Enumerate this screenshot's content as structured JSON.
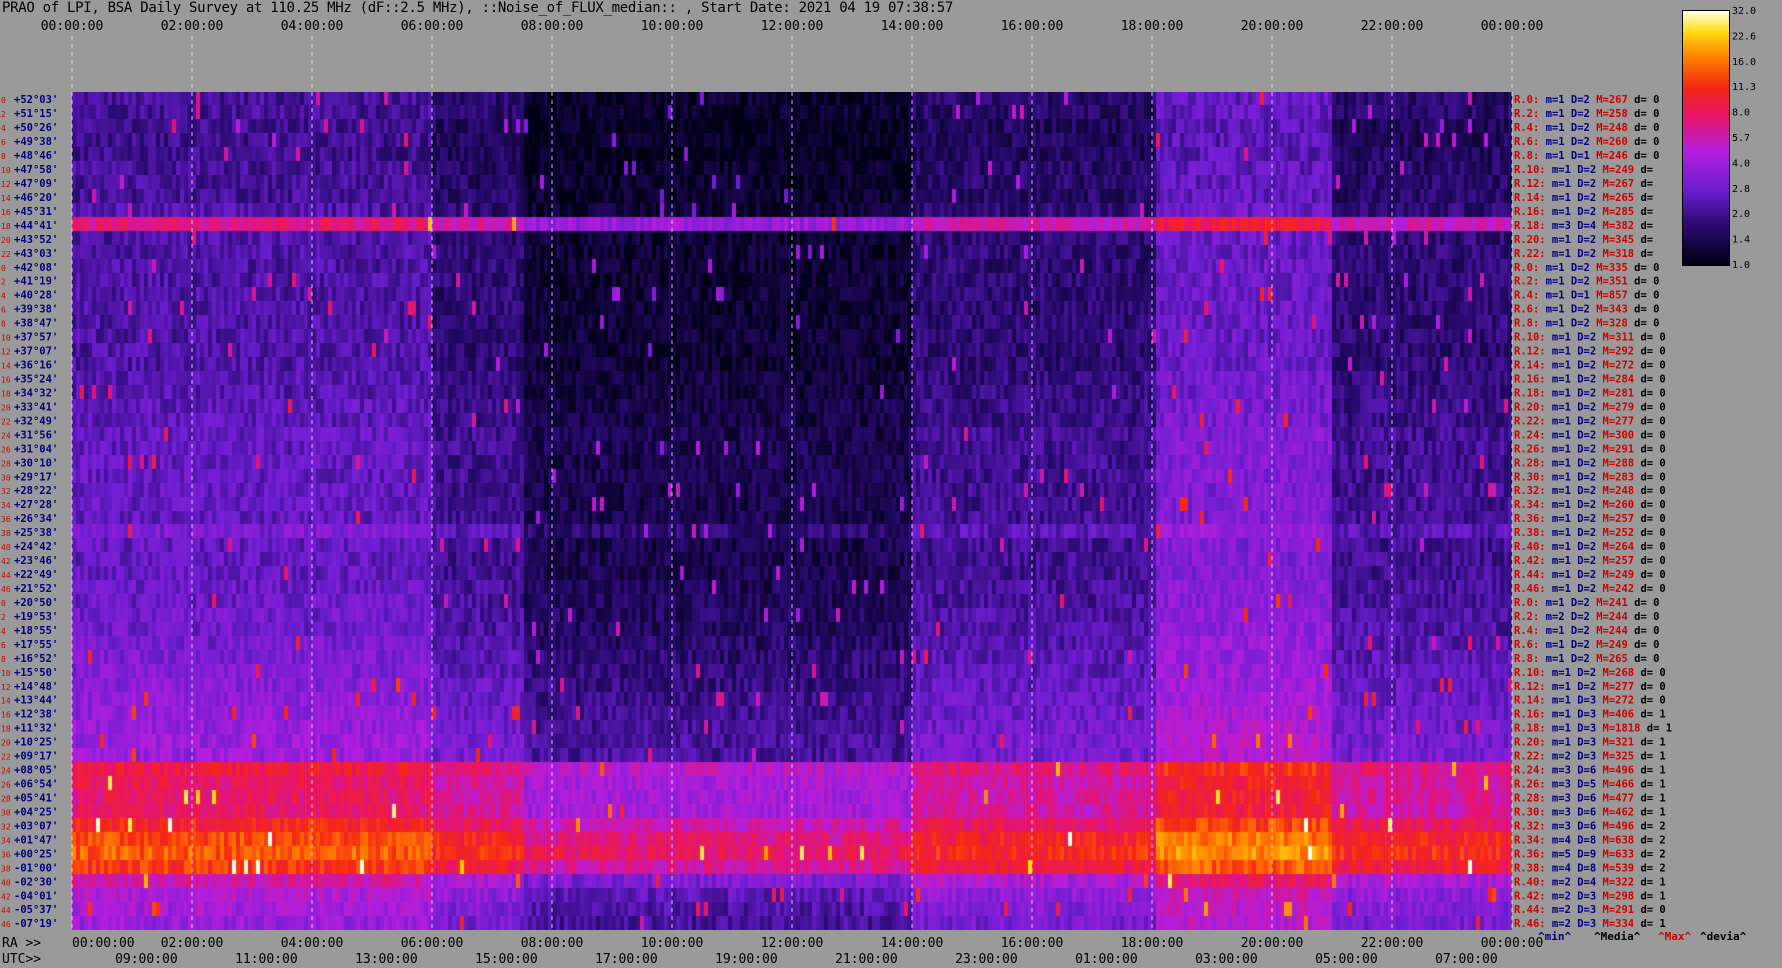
{
  "title": "PRAO of LPI, BSA Daily Survey at 110.25 MHz (dF::2.5 MHz), ::Noise_of_FLUX_median:: , Start Date: 2021 04 19 07:38:57",
  "top_axis": [
    "00:00:00",
    "02:00:00",
    "04:00:00",
    "06:00:00",
    "08:00:00",
    "10:00:00",
    "12:00:00",
    "14:00:00",
    "16:00:00",
    "18:00:00",
    "20:00:00",
    "22:00:00",
    "00:00:00"
  ],
  "bottom_ra_prefix": "RA >>",
  "bottom_ra": [
    "00:00:00",
    "02:00:00",
    "04:00:00",
    "06:00:00",
    "08:00:00",
    "10:00:00",
    "12:00:00",
    "14:00:00",
    "16:00:00",
    "18:00:00",
    "20:00:00",
    "22:00:00",
    "00:00:00"
  ],
  "bottom_utc_prefix": "UTC>>",
  "bottom_utc": [
    "09:00:00",
    "11:00:00",
    "13:00:00",
    "15:00:00",
    "17:00:00",
    "19:00:00",
    "21:00:00",
    "23:00:00",
    "01:00:00",
    "03:00:00",
    "05:00:00",
    "07:00:00"
  ],
  "colorbar": {
    "ticks": [
      "32.0",
      "22.6",
      "16.0",
      "11.3",
      "8.0",
      "5.7",
      "4.0",
      "2.8",
      "2.0",
      "1.4",
      "1.0"
    ]
  },
  "legend": {
    "min": "^min^",
    "median": "^Media^",
    "max": "^Max^",
    "devia": "^devia^"
  },
  "colors": {
    "bg": "#9a9a9a",
    "label_red": "#d00000",
    "label_navy": "#000080"
  },
  "chart_data": {
    "type": "heatmap",
    "title": "PRAO of LPI, BSA Daily Survey at 110.25 MHz (dF::2.5 MHz), ::Noise_of_FLUX_median:: , Start Date: 2021 04 19 07:38:57",
    "x_axis": "RA 00:00:00 to 00:00:00 (24 h)",
    "colorscale": {
      "min": 1.0,
      "max": 32.0,
      "scale": "log2"
    },
    "declinations": [
      "+52°03'",
      "+51°15'",
      "+50°26'",
      "+49°38'",
      "+48°46'",
      "+47°58'",
      "+47°09'",
      "+46°20'",
      "+45°31'",
      "+44°41'",
      "+43°52'",
      "+43°03'",
      "+42°08'",
      "+41°19'",
      "+40°28'",
      "+39°38'",
      "+38°47'",
      "+37°57'",
      "+37°07'",
      "+36°16'",
      "+35°24'",
      "+34°32'",
      "+33°41'",
      "+32°49'",
      "+31°56'",
      "+31°04'",
      "+30°10'",
      "+29°17'",
      "+28°22'",
      "+27°28'",
      "+26°34'",
      "+25°38'",
      "+24°42'",
      "+23°46'",
      "+22°49'",
      "+21°52'",
      "+20°50'",
      "+19°53'",
      "+18°55'",
      "+17°55'",
      "+16°52'",
      "+15°50'",
      "+14°48'",
      "+13°44'",
      "+12°38'",
      "+11°32'",
      "+10°25'",
      "+09°17'",
      "+08°05'",
      "+06°54'",
      "+05°41'",
      "+04°25'",
      "+03°07'",
      "+01°47'",
      "+00°25'",
      "-01°00'",
      "-02°30'",
      "-04°01'",
      "-05°37'",
      "-07°19'"
    ],
    "row_index_labels": [
      "0",
      "2",
      "4",
      "6",
      "8",
      "10",
      "12",
      "14",
      "16",
      "18",
      "20",
      "22",
      "0",
      "2",
      "4",
      "6",
      "8",
      "10",
      "12",
      "14",
      "16",
      "18",
      "20",
      "22",
      "24",
      "26",
      "28",
      "30",
      "32",
      "34",
      "36",
      "38",
      "40",
      "42",
      "44",
      "46",
      "0",
      "2",
      "4",
      "6",
      "8",
      "10",
      "12",
      "14",
      "16",
      "18",
      "20",
      "22",
      "24",
      "26",
      "28",
      "30",
      "32",
      "34",
      "36",
      "38",
      "40",
      "42",
      "44",
      "46"
    ],
    "row_stats": [
      {
        "r": "R.0:",
        "m": "1",
        "D": "2",
        "M": "267",
        "d": "0"
      },
      {
        "r": "R.2:",
        "m": "1",
        "D": "2",
        "M": "258",
        "d": "0"
      },
      {
        "r": "R.4:",
        "m": "1",
        "D": "2",
        "M": "248",
        "d": "0"
      },
      {
        "r": "R.6:",
        "m": "1",
        "D": "2",
        "M": "260",
        "d": "0"
      },
      {
        "r": "R.8:",
        "m": "1",
        "D": "1",
        "M": "246",
        "d": "0"
      },
      {
        "r": "R.10:",
        "m": "1",
        "D": "2",
        "M": "249",
        "d": ""
      },
      {
        "r": "R.12:",
        "m": "1",
        "D": "2",
        "M": "267",
        "d": ""
      },
      {
        "r": "R.14:",
        "m": "1",
        "D": "2",
        "M": "265",
        "d": ""
      },
      {
        "r": "R.16:",
        "m": "1",
        "D": "2",
        "M": "285",
        "d": ""
      },
      {
        "r": "R.18:",
        "m": "3",
        "D": "4",
        "M": "382",
        "d": ""
      },
      {
        "r": "R.20:",
        "m": "1",
        "D": "2",
        "M": "345",
        "d": ""
      },
      {
        "r": "R.22:",
        "m": "1",
        "D": "2",
        "M": "318",
        "d": ""
      },
      {
        "r": "R.0:",
        "m": "1",
        "D": "2",
        "M": "335",
        "d": "0"
      },
      {
        "r": "R.2:",
        "m": "1",
        "D": "2",
        "M": "351",
        "d": "0"
      },
      {
        "r": "R.4:",
        "m": "1",
        "D": "1",
        "M": "857",
        "d": "0"
      },
      {
        "r": "R.6:",
        "m": "1",
        "D": "2",
        "M": "343",
        "d": "0"
      },
      {
        "r": "R.8:",
        "m": "1",
        "D": "2",
        "M": "328",
        "d": "0"
      },
      {
        "r": "R.10:",
        "m": "1",
        "D": "2",
        "M": "311",
        "d": "0"
      },
      {
        "r": "R.12:",
        "m": "1",
        "D": "2",
        "M": "292",
        "d": "0"
      },
      {
        "r": "R.14:",
        "m": "1",
        "D": "2",
        "M": "272",
        "d": "0"
      },
      {
        "r": "R.16:",
        "m": "1",
        "D": "2",
        "M": "284",
        "d": "0"
      },
      {
        "r": "R.18:",
        "m": "1",
        "D": "2",
        "M": "281",
        "d": "0"
      },
      {
        "r": "R.20:",
        "m": "1",
        "D": "2",
        "M": "279",
        "d": "0"
      },
      {
        "r": "R.22:",
        "m": "1",
        "D": "2",
        "M": "277",
        "d": "0"
      },
      {
        "r": "R.24:",
        "m": "1",
        "D": "2",
        "M": "300",
        "d": "0"
      },
      {
        "r": "R.26:",
        "m": "1",
        "D": "2",
        "M": "291",
        "d": "0"
      },
      {
        "r": "R.28:",
        "m": "1",
        "D": "2",
        "M": "288",
        "d": "0"
      },
      {
        "r": "R.30:",
        "m": "1",
        "D": "2",
        "M": "283",
        "d": "0"
      },
      {
        "r": "R.32:",
        "m": "1",
        "D": "2",
        "M": "248",
        "d": "0"
      },
      {
        "r": "R.34:",
        "m": "1",
        "D": "2",
        "M": "260",
        "d": "0"
      },
      {
        "r": "R.36:",
        "m": "1",
        "D": "2",
        "M": "257",
        "d": "0"
      },
      {
        "r": "R.38:",
        "m": "1",
        "D": "2",
        "M": "252",
        "d": "0"
      },
      {
        "r": "R.40:",
        "m": "1",
        "D": "2",
        "M": "264",
        "d": "0"
      },
      {
        "r": "R.42:",
        "m": "1",
        "D": "2",
        "M": "257",
        "d": "0"
      },
      {
        "r": "R.44:",
        "m": "1",
        "D": "2",
        "M": "249",
        "d": "0"
      },
      {
        "r": "R.46:",
        "m": "1",
        "D": "2",
        "M": "242",
        "d": "0"
      },
      {
        "r": "R.0:",
        "m": "1",
        "D": "2",
        "M": "241",
        "d": "0"
      },
      {
        "r": "R.2:",
        "m": "2",
        "D": "2",
        "M": "244",
        "d": "0"
      },
      {
        "r": "R.4:",
        "m": "1",
        "D": "2",
        "M": "244",
        "d": "0"
      },
      {
        "r": "R.6:",
        "m": "1",
        "D": "2",
        "M": "249",
        "d": "0"
      },
      {
        "r": "R.8:",
        "m": "1",
        "D": "2",
        "M": "265",
        "d": "0"
      },
      {
        "r": "R.10:",
        "m": "1",
        "D": "2",
        "M": "268",
        "d": "0"
      },
      {
        "r": "R.12:",
        "m": "1",
        "D": "2",
        "M": "277",
        "d": "0"
      },
      {
        "r": "R.14:",
        "m": "1",
        "D": "3",
        "M": "272",
        "d": "0"
      },
      {
        "r": "R.16:",
        "m": "1",
        "D": "3",
        "M": "406",
        "d": "1"
      },
      {
        "r": "R.18:",
        "m": "1",
        "D": "3",
        "M": "1818",
        "d": "1"
      },
      {
        "r": "R.20:",
        "m": "1",
        "D": "3",
        "M": "321",
        "d": "1"
      },
      {
        "r": "R.22:",
        "m": "2",
        "D": "3",
        "M": "325",
        "d": "1"
      },
      {
        "r": "R.24:",
        "m": "3",
        "D": "6",
        "M": "496",
        "d": "1"
      },
      {
        "r": "R.26:",
        "m": "3",
        "D": "5",
        "M": "466",
        "d": "1"
      },
      {
        "r": "R.28:",
        "m": "3",
        "D": "6",
        "M": "477",
        "d": "1"
      },
      {
        "r": "R.30:",
        "m": "3",
        "D": "6",
        "M": "462",
        "d": "1"
      },
      {
        "r": "R.32:",
        "m": "3",
        "D": "6",
        "M": "496",
        "d": "2"
      },
      {
        "r": "R.34:",
        "m": "4",
        "D": "8",
        "M": "638",
        "d": "2"
      },
      {
        "r": "R.36:",
        "m": "5",
        "D": "9",
        "M": "633",
        "d": "2"
      },
      {
        "r": "R.38:",
        "m": "4",
        "D": "8",
        "M": "539",
        "d": "2"
      },
      {
        "r": "R.40:",
        "m": "2",
        "D": "4",
        "M": "322",
        "d": "1"
      },
      {
        "r": "R.42:",
        "m": "2",
        "D": "3",
        "M": "298",
        "d": "1"
      },
      {
        "r": "R.44:",
        "m": "2",
        "D": "3",
        "M": "291",
        "d": "0"
      },
      {
        "r": "R.46:",
        "m": "2",
        "D": "3",
        "M": "334",
        "d": "1"
      }
    ],
    "row_level_estimate": [
      1.6,
      1.6,
      1.5,
      1.5,
      1.5,
      1.6,
      1.6,
      1.6,
      1.7,
      5.5,
      1.7,
      1.7,
      1.7,
      1.7,
      1.7,
      1.7,
      1.7,
      1.7,
      1.7,
      1.7,
      1.8,
      1.8,
      1.9,
      1.9,
      2.0,
      2.0,
      2.0,
      2.0,
      2.0,
      2.0,
      2.0,
      2.4,
      2.0,
      2.0,
      2.0,
      2.1,
      2.1,
      2.2,
      2.2,
      2.3,
      2.4,
      2.5,
      2.6,
      2.7,
      2.8,
      2.9,
      3.0,
      3.0,
      7.0,
      6.0,
      6.0,
      6.0,
      8.0,
      10.0,
      11.0,
      9.0,
      4.5,
      3.5,
      3.2,
      3.0
    ]
  }
}
